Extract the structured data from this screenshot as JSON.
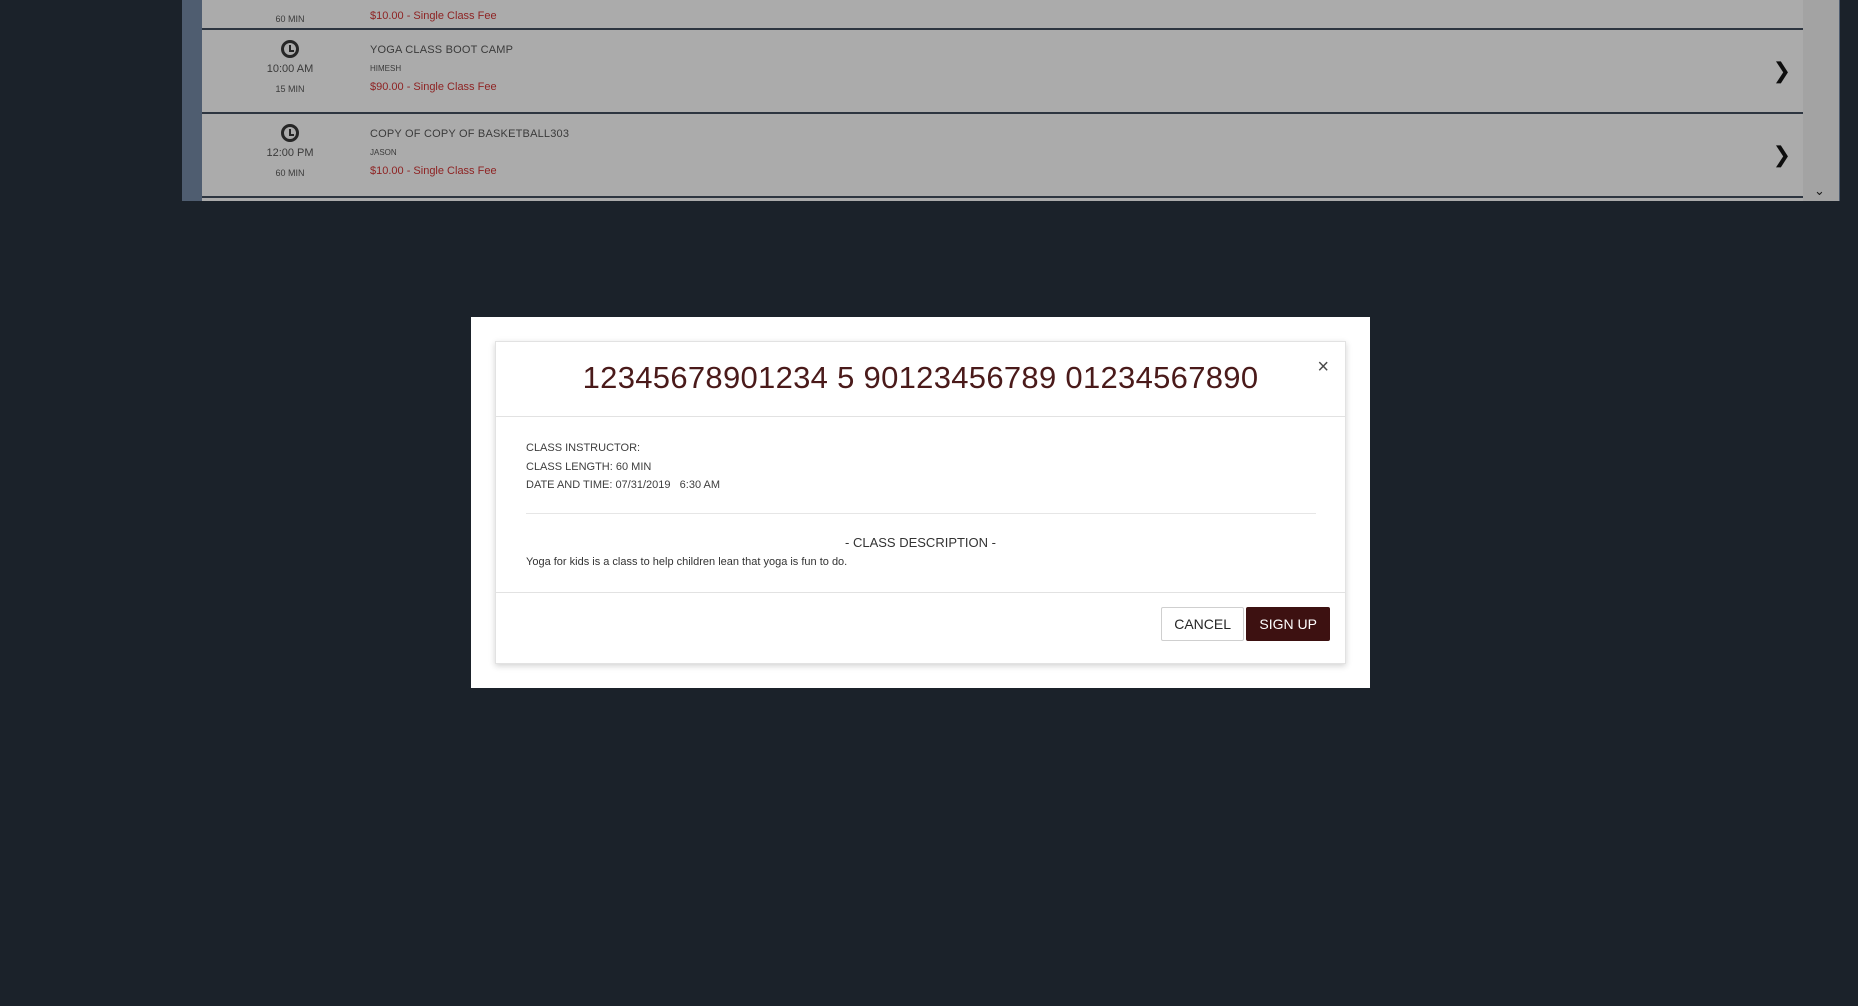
{
  "schedule": {
    "partial_top": {
      "duration": "60 MIN",
      "fee": "$10.00 - Single Class Fee"
    },
    "rows": [
      {
        "time": "10:00 AM",
        "duration": "15 MIN",
        "title": "YOGA CLASS BOOT CAMP",
        "instructor": "HIMESH",
        "fee": "$90.00 - Single Class Fee"
      },
      {
        "time": "12:00 PM",
        "duration": "60 MIN",
        "title": "COPY OF COPY OF BASKETBALL303",
        "instructor": "JASON",
        "fee": "$10.00 - Single Class Fee"
      }
    ],
    "scroll_arrow": "⌄"
  },
  "modal": {
    "title": "12345678901234 5 90123456789 01234567890",
    "close_label": "×",
    "instructor_line": "CLASS INSTRUCTOR:",
    "length_line": "CLASS LENGTH: 60 MIN",
    "datetime_line": "DATE AND TIME: 07/31/2019   6:30 AM",
    "description_heading": "- CLASS DESCRIPTION -",
    "description_text": "Yoga for kids is a class to help children lean that yoga is fun to do.",
    "cancel_label": "CANCEL",
    "signup_label": "SIGN UP"
  },
  "colors": {
    "backdrop": "#1b222a",
    "accent": "#3d1111",
    "fee_text": "#8e2323"
  }
}
